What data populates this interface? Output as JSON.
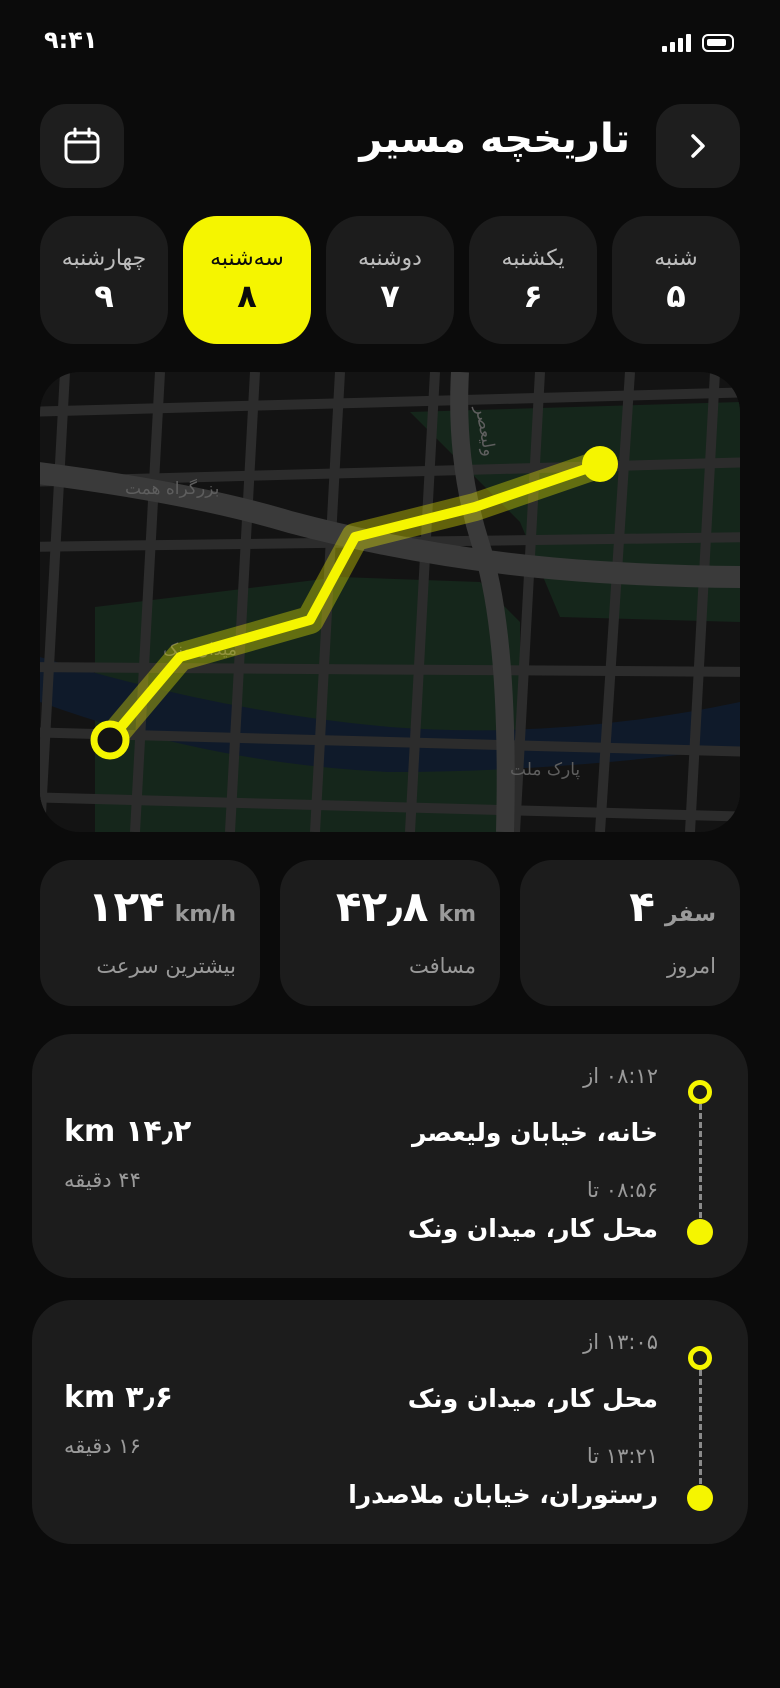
{
  "status": {
    "time": "۹:۴۱"
  },
  "header": {
    "title": "تاریخچه مسیر"
  },
  "days": [
    {
      "name": "شنبه",
      "num": "۵",
      "active": false
    },
    {
      "name": "یکشنبه",
      "num": "۶",
      "active": false
    },
    {
      "name": "دوشنبه",
      "num": "۷",
      "active": false
    },
    {
      "name": "سه‌شنبه",
      "num": "۸",
      "active": true
    },
    {
      "name": "چهارشنبه",
      "num": "۹",
      "active": false
    }
  ],
  "map": {
    "labels": {
      "highway": "بزرگراه همت",
      "valiasr": "ولیعصر",
      "vanak": "میدان ونک",
      "park": "پارک ملت"
    }
  },
  "stats": [
    {
      "value": "۴",
      "unit": "سفر",
      "label": "امروز"
    },
    {
      "value": "۴۲٫۸",
      "unit": "km",
      "label": "مسافت"
    },
    {
      "value": "۱۲۴",
      "unit": "km/h",
      "label": "بیشترین سرعت"
    }
  ],
  "trips": [
    {
      "from_time": "۰۸:۱۲ از",
      "from_place": "خانه، خیابان ولیعصر",
      "to_time": "۰۸:۵۶ تا",
      "to_place": "محل کار، میدان ونک",
      "distance": "۱۴٫۲",
      "distance_unit": "km",
      "duration": "۴۴ دقیقه"
    },
    {
      "from_time": "۱۳:۰۵ از",
      "from_place": "محل کار، میدان ونک",
      "to_time": "۱۳:۲۱ تا",
      "to_place": "رستوران، خیابان ملاصدرا",
      "distance": "۳٫۶",
      "distance_unit": "km",
      "duration": "۱۶ دقیقه"
    }
  ],
  "colors": {
    "accent": "#f5f500",
    "background": "#0b0b0b",
    "card": "#1c1c1c"
  },
  "icons": {
    "back": "chevron-right-icon",
    "calendar": "calendar-icon"
  }
}
